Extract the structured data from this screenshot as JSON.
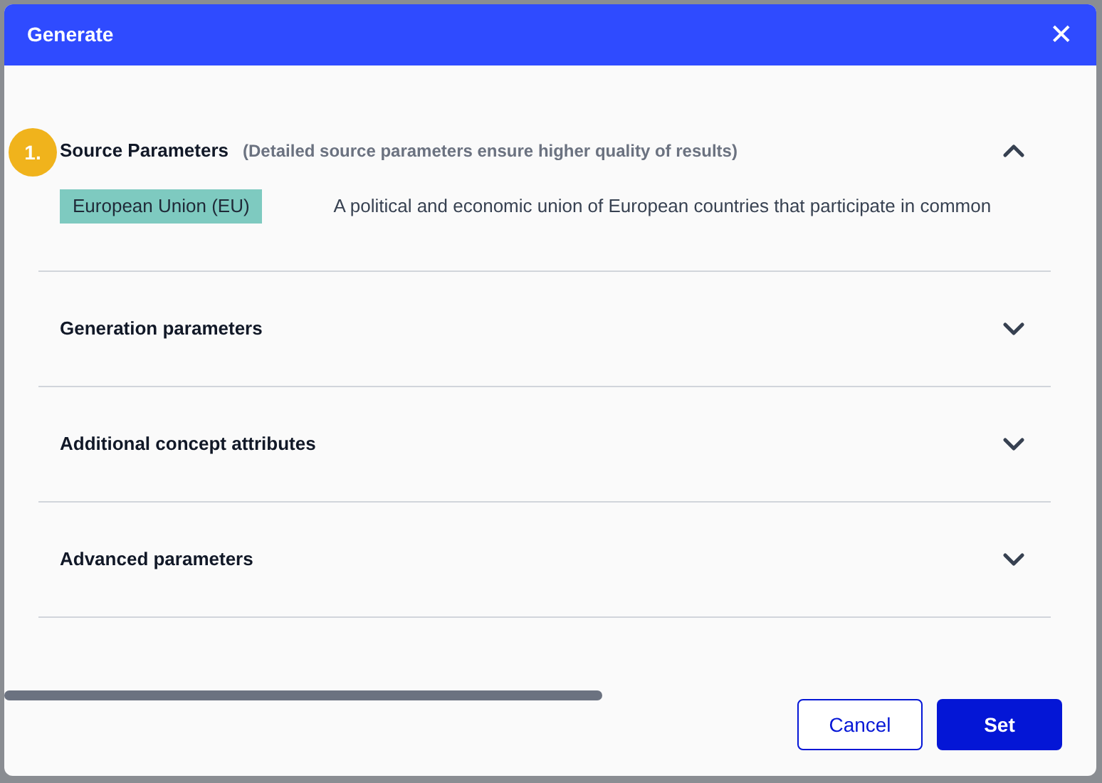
{
  "dialog": {
    "title": "Generate",
    "close": "✕"
  },
  "sections": [
    {
      "step": "1.",
      "title": "Source Parameters",
      "subtitle": "(Detailed source parameters ensure higher quality of results)",
      "expanded": true,
      "items": [
        {
          "tag": "European Union (EU)",
          "description": "A political and economic union of European countries that participate in common"
        }
      ]
    },
    {
      "title": "Generation parameters",
      "expanded": false
    },
    {
      "title": "Additional concept attributes",
      "expanded": false
    },
    {
      "title": "Advanced parameters",
      "expanded": false
    }
  ],
  "buttons": [
    {
      "label": "Cancel",
      "kind": "secondary"
    },
    {
      "label": "Set",
      "kind": "primary"
    }
  ]
}
